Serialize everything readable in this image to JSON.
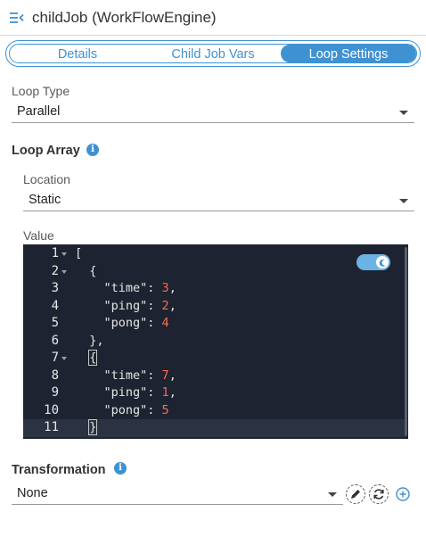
{
  "header": {
    "title": "childJob (WorkFlowEngine)",
    "menu_icon": "menu-collapse-icon"
  },
  "tabs": [
    {
      "label": "Details",
      "active": false
    },
    {
      "label": "Child Job Vars",
      "active": false
    },
    {
      "label": "Loop Settings",
      "active": true
    }
  ],
  "loop_type": {
    "label": "Loop Type",
    "value": "Parallel"
  },
  "loop_array": {
    "title": "Loop Array",
    "info_icon": "info-icon",
    "location": {
      "label": "Location",
      "value": "Static"
    },
    "value_label": "Value",
    "editor": {
      "theme_toggle": "dark-mode-toggle",
      "active_line": 11,
      "lines": [
        {
          "n": "1",
          "text": "[",
          "fold": true
        },
        {
          "n": "2",
          "text": "  {",
          "fold": true
        },
        {
          "n": "3",
          "key": "\"time\"",
          "num": "3",
          "trail": ","
        },
        {
          "n": "4",
          "key": "\"ping\"",
          "num": "2",
          "trail": ","
        },
        {
          "n": "5",
          "key": "\"pong\"",
          "num": "4",
          "trail": ""
        },
        {
          "n": "6",
          "text": "  },",
          "fold": false
        },
        {
          "n": "7",
          "text": "  {",
          "fold": true,
          "hl": true
        },
        {
          "n": "8",
          "key": "\"time\"",
          "num": "7",
          "trail": ","
        },
        {
          "n": "9",
          "key": "\"ping\"",
          "num": "1",
          "trail": ","
        },
        {
          "n": "10",
          "key": "\"pong\"",
          "num": "5",
          "trail": ""
        },
        {
          "n": "11",
          "text": "  }",
          "fold": false,
          "hl": true
        }
      ]
    }
  },
  "transformation": {
    "title": "Transformation",
    "info_icon": "info-icon",
    "value": "None",
    "edit_icon": "pencil-icon",
    "refresh_icon": "refresh-icon",
    "add_icon": "plus-circle-icon"
  },
  "colors": {
    "accent": "#3f92d2",
    "editor_bg": "#1d2330",
    "number": "#ff6a50"
  }
}
